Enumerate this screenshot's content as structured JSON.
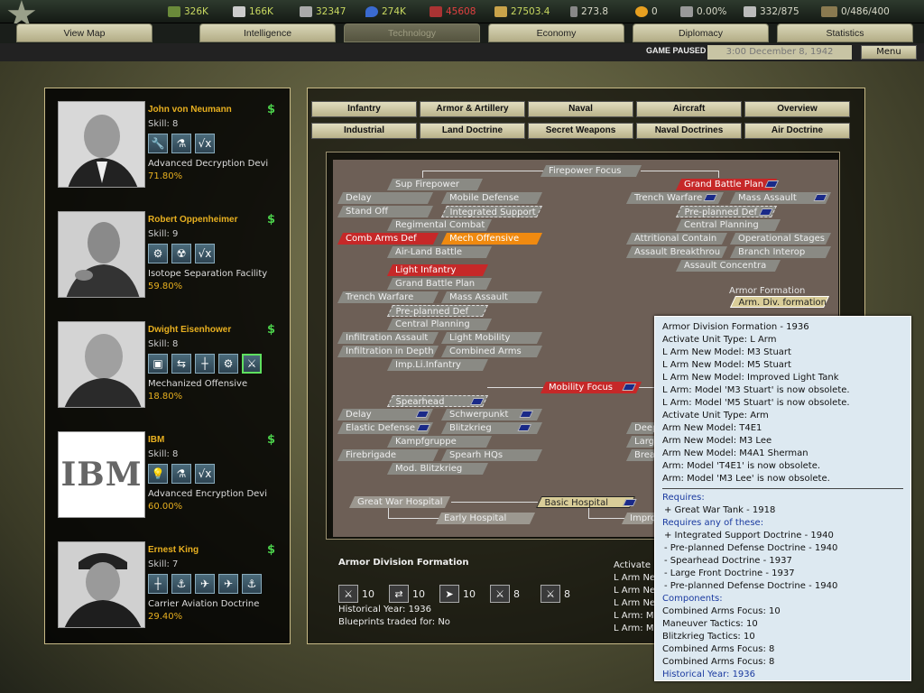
{
  "resources": [
    {
      "icon": "energy-icon",
      "value": "326K",
      "color": "#c8d860"
    },
    {
      "icon": "metal-icon",
      "value": "166K",
      "color": "#c8d860"
    },
    {
      "icon": "rare-materials-icon",
      "value": "32347",
      "color": "#c8d860"
    },
    {
      "icon": "oil-icon",
      "value": "274K",
      "color": "#c8d860"
    },
    {
      "icon": "supplies-icon",
      "value": "45608",
      "color": "#e04040"
    },
    {
      "icon": "money-icon",
      "value": "27503.4",
      "color": "#c8d860"
    },
    {
      "icon": "manpower-icon",
      "value": "273.8",
      "color": "#d8d8c8"
    },
    {
      "icon": "transports-icon",
      "value": "0",
      "color": "#d8d8c8"
    },
    {
      "icon": "dissent-icon",
      "value": "0.00%",
      "color": "#d8d8c8"
    },
    {
      "icon": "convoy-icon",
      "value": "332/875",
      "color": "#d8d8c8"
    },
    {
      "icon": "escorts-icon",
      "value": "0/486/400",
      "color": "#d8d8c8"
    }
  ],
  "tabs": [
    "View Map",
    "Intelligence",
    "Technology",
    "Economy",
    "Diplomacy",
    "Statistics"
  ],
  "status": {
    "paused": "GAME PAUSED",
    "date": "3:00 December 8, 1942",
    "menu": "Menu"
  },
  "teams": [
    {
      "name": "John von Neumann",
      "skill": "Skill: 8",
      "project": "Advanced Decryption Devi",
      "progress": "71.80%",
      "icons": [
        "🔧",
        "⚗",
        "√x"
      ]
    },
    {
      "name": "Robert Oppenheimer",
      "skill": "Skill: 9",
      "project": "Isotope Separation Facility",
      "progress": "59.80%",
      "icons": [
        "⚙",
        "☢",
        "√x"
      ]
    },
    {
      "name": "Dwight Eisenhower",
      "skill": "Skill: 8",
      "project": "Mechanized Offensive",
      "progress": "18.80%",
      "icons": [
        "▣",
        "⇆",
        "┼",
        "⚙",
        "⚔"
      ]
    },
    {
      "name": "IBM",
      "skill": "Skill: 8",
      "project": "Advanced Encryption Devi",
      "progress": "60.00%",
      "icons": [
        "💡",
        "⚗",
        "√x"
      ]
    },
    {
      "name": "Ernest King",
      "skill": "Skill: 7",
      "project": "Carrier Aviation Doctrine",
      "progress": "29.40%",
      "icons": [
        "┼",
        "⚓",
        "✈",
        "✈",
        "⚓"
      ]
    }
  ],
  "ibm_logo": "IBM",
  "categories": [
    "Infantry",
    "Armor & Artillery",
    "Naval",
    "Aircraft",
    "Overview",
    "Industrial",
    "Land Doctrine",
    "Secret Weapons",
    "Naval Doctrines",
    "Air Doctrine"
  ],
  "tree": {
    "firepower_focus": "Firepower Focus",
    "sup_firepower": "Sup Firepower",
    "delay": "Delay",
    "mobile_defense": "Mobile Defense",
    "stand_off": "Stand Off",
    "integrated_support": "Integrated Support",
    "regimental_combat": "Regimental Combat",
    "comb_arms_def": "Comb Arms Def",
    "mech_offensive": "Mech Offensive",
    "air_land_battle": "Air-Land Battle",
    "light_infantry": "Light Infantry",
    "grand_battle_plan": "Grand Battle Plan",
    "trench_warfare": "Trench Warfare",
    "mass_assault": "Mass Assault",
    "pre_planned_def": "Pre-planned Def",
    "central_planning": "Central Planning",
    "infiltration_assault": "Infiltration Assault",
    "light_mobility": "Light Mobility",
    "infiltration_depth": "Infiltration in Depth",
    "combined_arms": "Combined Arms",
    "imp_li_infantry": "Imp.Li.Infantry",
    "r_grand_battle_plan": "Grand Battle Plan",
    "r_trench_warfare": "Trench Warfare",
    "r_mass_assault": "Mass Assault",
    "r_pre_planned_def": "Pre-planned Def",
    "r_central_planning": "Central Planning",
    "attritional_contain": "Attritional Contain",
    "operational_stages": "Operational Stages",
    "assault_breakthrou": "Assault Breakthrou",
    "branch_interop": "Branch Interop",
    "assault_concentra": "Assault Concentra",
    "armor_formation_label": "Armor Formation",
    "arm_div_formation": "Arm. Div. formation",
    "mobility_focus": "Mobility Focus",
    "spearhead": "Spearhead",
    "m_delay": "Delay",
    "schwerpunkt": "Schwerpunkt",
    "elastic_defense": "Elastic Defense",
    "blitzkrieg": "Blitzkrieg",
    "kampfgruppe": "Kampfgruppe",
    "firebrigade": "Firebrigade",
    "spearh_hqs": "Spearh HQs",
    "mod_blitzkrieg": "Mod. Blitzkrieg",
    "deep": "Deep",
    "large": "Large",
    "brea": "Brea",
    "great_war_hospital": "Great War Hospital",
    "basic_hospital": "Basic Hospital",
    "early_hospital": "Early Hospital",
    "impro": "Impro"
  },
  "selected_tech": {
    "title": "Armor Division Formation",
    "components": [
      {
        "icon": "⚔",
        "value": "10"
      },
      {
        "icon": "⇄",
        "value": "10"
      },
      {
        "icon": "➤",
        "value": "10"
      },
      {
        "icon": "⚔",
        "value": "8"
      },
      {
        "icon": "⚔",
        "value": "8"
      }
    ],
    "historical_year": "Historical Year: 1936",
    "blueprints": "Blueprints traded for: No",
    "effects_preview": [
      "Activate",
      "L Arm New",
      "L Arm New",
      "L Arm New",
      "L Arm: Mo",
      "L Arm: Mo"
    ]
  },
  "tooltip": {
    "title": "Armor Division Formation - 1936",
    "effects": [
      "Activate Unit Type: L Arm",
      "L Arm New Model: M3 Stuart",
      "L Arm New Model: M5 Stuart",
      "L Arm New Model: Improved Light Tank",
      "L Arm: Model 'M3 Stuart' is now obsolete.",
      "L Arm: Model 'M5 Stuart' is now obsolete.",
      "Activate Unit Type: Arm",
      "Arm New Model: T4E1",
      "Arm New Model: M3 Lee",
      "Arm New Model: M4A1 Sherman",
      "Arm: Model 'T4E1' is now obsolete.",
      "Arm: Model 'M3 Lee' is now obsolete."
    ],
    "requires_label": "Requires:",
    "requires": [
      "+ Great War Tank - 1918"
    ],
    "requires_any_label": "Requires any of these:",
    "requires_any": [
      "+ Integrated Support Doctrine - 1940",
      "- Pre-planned Defense Doctrine - 1940",
      "- Spearhead Doctrine - 1937",
      "- Large Front Doctrine - 1937",
      "- Pre-planned Defense Doctrine - 1940"
    ],
    "components_label": "Components:",
    "components": [
      "Combined Arms Focus: 10",
      "Maneuver Tactics: 10",
      "Blitzkrieg Tactics: 10",
      "Combined Arms Focus: 8",
      "Combined Arms Focus: 8"
    ],
    "historical": "Historical Year: 1936"
  },
  "colors": {
    "accent_gold": "#e8b020",
    "money_green": "#4bd04b",
    "tooltip_bg": "#dde9f1",
    "red_node": "#c62828",
    "orange_node": "#f08a10"
  }
}
